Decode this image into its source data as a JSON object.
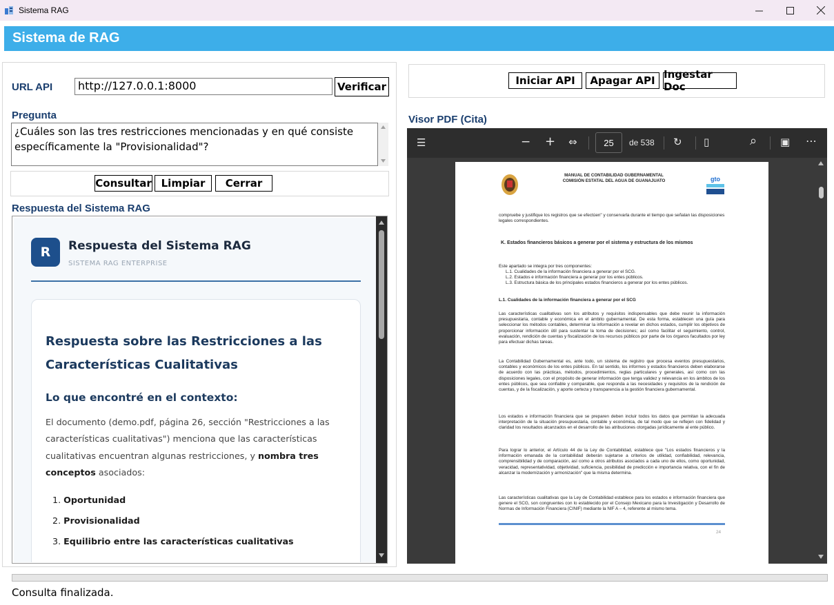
{
  "window": {
    "title": "Sistema RAG",
    "minimize": "—",
    "maximize": "☐",
    "close": "✕"
  },
  "header": {
    "title": "Sistema de RAG"
  },
  "left": {
    "url_label": "URL API",
    "url_value": "http://127.0.0.1:8000",
    "verify_label": "Verificar",
    "question_label": "Pregunta",
    "question_value": "¿Cuáles son las tres restricciones mencionadas y en qué consiste específicamente la \"Provisionalidad\"?",
    "buttons": {
      "consult": "Consultar",
      "clear": "Limpiar",
      "close": "Cerrar"
    },
    "response_label": "Respuesta del Sistema RAG"
  },
  "response": {
    "avatar_letter": "R",
    "title": "Respuesta del Sistema RAG",
    "subtitle": "SISTEMA RAG ENTERPRISE",
    "heading": "Respuesta sobre las Restricciones a las Características Cualitativas",
    "subheading": "Lo que encontré en el contexto:",
    "paragraph_start": "El documento (demo.pdf, página 26, sección \"Restricciones a las características cualitativas\") menciona que las características cualitativas encuentran algunas restricciones, y ",
    "paragraph_bold": "nombra tres conceptos",
    "paragraph_end": " asociados:",
    "items": [
      "Oportunidad",
      "Provisionalidad",
      "Equilibrio entre las características cualitativas"
    ]
  },
  "right": {
    "buttons": {
      "start": "Iniciar API",
      "stop": "Apagar API",
      "ingest": "Ingestar Doc"
    },
    "viewer_label": "Visor PDF (Cita)"
  },
  "pdf_toolbar": {
    "page": "25",
    "of_pages": "de 538",
    "menu_icon": "☰",
    "zoom_out": "−",
    "zoom_in": "+",
    "fit_icon": "⇔",
    "rotate_icon": "↻",
    "layout_icon": "▯",
    "search_icon": "⌕",
    "save_icon": "▣",
    "more_icon": "⋯"
  },
  "pdf_page": {
    "header_line1": "MANUAL DE CONTABILIDAD GUBERNAMENTAL",
    "header_line2": "COMISIÓN ESTATAL DEL AGUA DE GUANAJUATO",
    "logo_text": "gto",
    "p0": "compruebe y justifique los registros que se efectúen\" y conservarla durante el tiempo que señalan las disposiciones legales correspondientes.",
    "sectionK": "K.   Estados financieros básicos a generar por el sistema y estructura de los mismos",
    "intro": "Este apartado se integra por tres componentes:",
    "list": [
      "L.1.   Cualidades de la información financiera a generar por el SCG.",
      "L.2.   Estados e información financiera a generar por los entes públicos.",
      "L.3.   Estructura básica de los principales estados financieros a generar por los entes públicos."
    ],
    "sub_heading": "L.1. Cualidades de la información financiera a generar por el SCG",
    "p1": "Las características cualitativas son los atributos y requisitos indispensables que debe reunir la información presupuestaria, contable y económica en el ámbito gubernamental. De esta forma, establecen una guía para seleccionar los métodos contables, determinar la información a revelar en dichos estados, cumplir los objetivos de proporcionar información útil para sustentar la toma de decisiones; así como facilitar el seguimiento, control, evaluación, rendición de cuentas y fiscalización de los recursos públicos por parte de los órganos facultados por ley para efectuar dichas tareas.",
    "p2": "La Contabilidad Gubernamental es, ante todo, un sistema de registro que procesa eventos presupuestarios, contables y económicos de los entes públicos. En tal sentido, los informes y estados financieros deben elaborarse de acuerdo con las prácticas, métodos, procedimientos, reglas particulares y generales, así como con las disposiciones legales, con el propósito de generar información que tenga validez y relevancia en los ámbitos de los entes públicos, que sea confiable y comparable, que responda a las necesidades y requisitos de la rendición de cuentas, y de la fiscalización, y aporte certeza y transparencia a la gestión financiera gubernamental.",
    "p3": "Los estados e información financiera que se preparen deben incluir todos los datos que permitan la adecuada interpretación de la situación presupuestaria, contable y económica, de tal modo que se reflejen con fidelidad y claridad los resultados alcanzados en el desarrollo de las atribuciones otorgadas jurídicamente al ente público.",
    "p4": "Para lograr lo anterior, el Artículo 44 de la Ley de Contabilidad, establece que \"Los estados financieros y la información emanada de la contabilidad deberán sujetarse a criterios de utilidad, confiabilidad, relevancia, comprensibilidad y de comparación, así como a otros atributos asociados a cada uno de ellos, como oportunidad, veracidad, representatividad, objetividad, suficiencia, posibilidad de predicción e importancia relativa, con el fin de alcanzar la modernización y armonización\" que la misma determina.",
    "p5": "Las características cualitativas que la Ley de Contabilidad establece para los estados e información financiera que genere el SCG, son congruentes con lo establecido por el Consejo Mexicano para la Investigación y Desarrollo de Normas de Información Financiera (CINIF) mediante la NIF A – 4, referente al mismo tema.",
    "footer_num": "24"
  },
  "status": {
    "text": "Consulta finalizada."
  },
  "colors": {
    "header": "#3daee9",
    "label": "#1a3e6e",
    "avatar": "#1d4f8c"
  }
}
